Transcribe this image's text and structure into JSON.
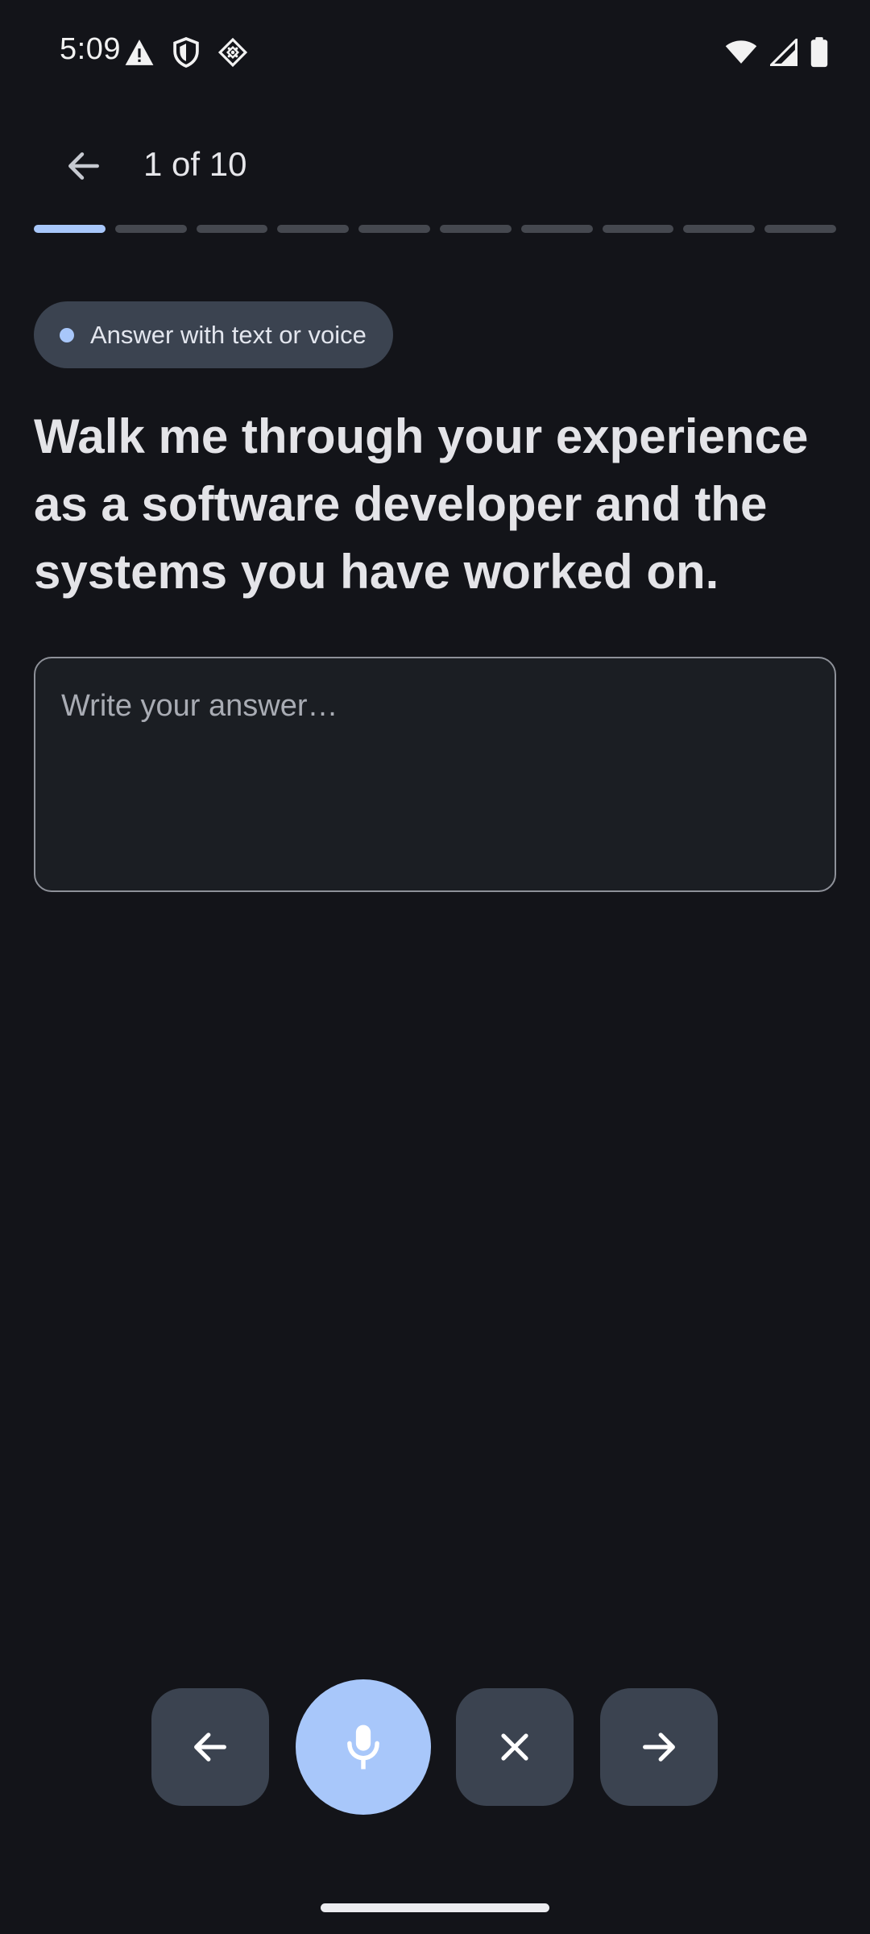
{
  "status_bar": {
    "time": "5:09",
    "left_icons": [
      "warning-icon",
      "shield-icon",
      "diamond-grid-icon"
    ],
    "right_icons": [
      "wifi-icon",
      "cell-signal-icon",
      "battery-icon"
    ]
  },
  "header": {
    "back_icon": "arrow-left-icon",
    "step_label": "1 of 10"
  },
  "progress": {
    "current": 1,
    "total": 10
  },
  "hint_chip": {
    "label": "Answer with text or voice"
  },
  "question": {
    "text": "Walk me through your experience as a software developer and the systems you have worked on."
  },
  "answer": {
    "placeholder": "Write your answer…",
    "value": ""
  },
  "controls": {
    "previous_icon": "arrow-left-icon",
    "mic_icon": "microphone-icon",
    "clear_icon": "close-icon",
    "next_icon": "arrow-right-icon"
  },
  "colors": {
    "background": "#131419",
    "accent": "#a8c7fa",
    "chip_background": "#3b4350",
    "progress_inactive": "#45484f",
    "field_border": "#8e9199"
  }
}
